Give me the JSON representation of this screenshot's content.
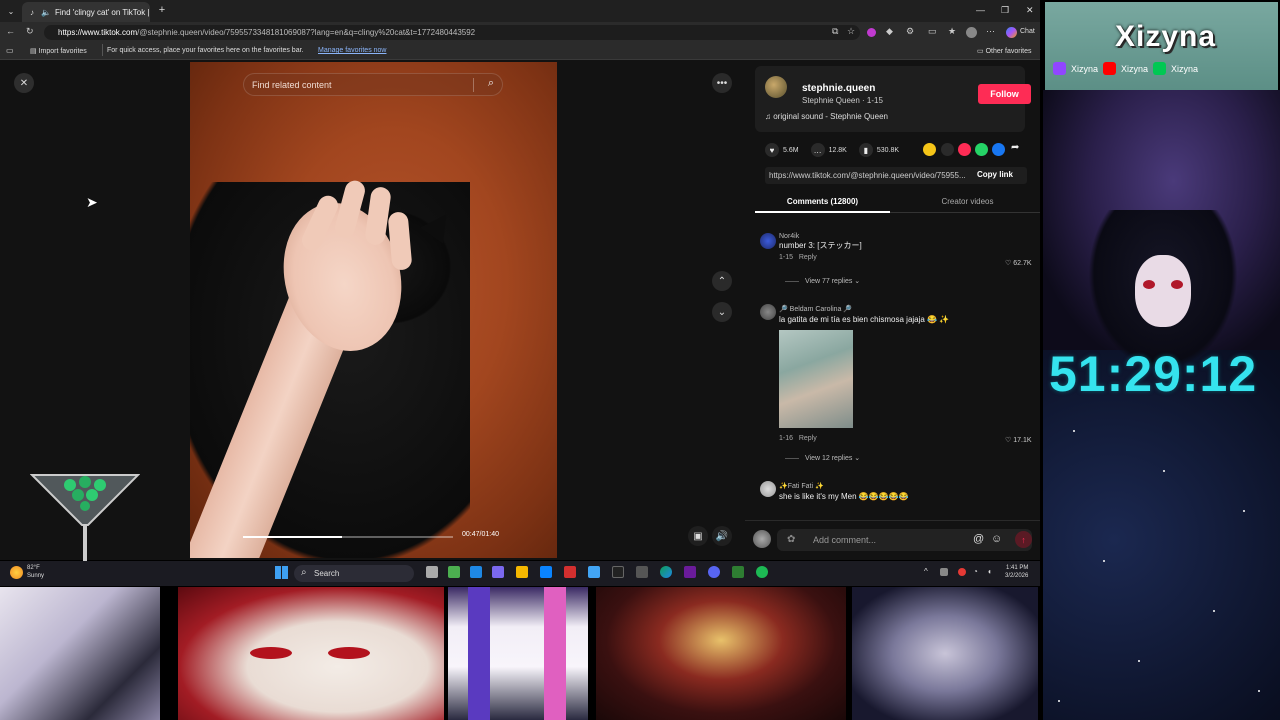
{
  "browser": {
    "tab_title": "Find 'clingy cat' on TikTok | Ti",
    "url_host": "https://www.tiktok.com",
    "url_path": "/@stephnie.queen/video/7595573348181069087?lang=en&q=clingy%20cat&t=1772480443592",
    "fav_import": "Import favorites",
    "fav_hint": "For quick access, place your favorites here on the favorites bar.",
    "fav_manage": "Manage favorites now",
    "fav_other": "Other favorites",
    "chat_label": "Chat"
  },
  "video": {
    "search_placeholder": "Find related content",
    "time": "00:47/01:40",
    "progress": 0.47
  },
  "author": {
    "username": "stephnie.queen",
    "subline": "Stephnie Queen · 1-15",
    "follow": "Follow",
    "sound": "original sound - Stephnie Queen"
  },
  "stats": {
    "likes": "5.6M",
    "comments": "12.8K",
    "saves": "530.8K"
  },
  "share": {
    "link": "https://www.tiktok.com/@stephnie.queen/video/75955...",
    "copy": "Copy link"
  },
  "tabs": {
    "comments": "Comments (12800)",
    "creator": "Creator videos"
  },
  "comments": [
    {
      "user": "Nor4ik",
      "text": "number 3: [ステッカー]",
      "date": "1-15",
      "reply": "Reply",
      "likes": "62.7K",
      "view": "View 77 replies"
    },
    {
      "user": "🔎 Beldam Carolina 🔎",
      "text": "la gatita de mi tía es bien chismosa jajaja 😂 ✨",
      "date": "1-16",
      "reply": "Reply",
      "likes": "17.1K",
      "view": "View 12 replies"
    },
    {
      "user": "✨Fati Fati ✨",
      "text": "she is like it's my Men 😂😂😂😂😂"
    }
  ],
  "composer": {
    "placeholder": "Add comment..."
  },
  "taskbar": {
    "temp": "82°F",
    "weather": "Sunny",
    "search": "Search",
    "time": "1:41 PM",
    "date": "3/2/2026"
  },
  "overlay": {
    "streamer": "Xizyna",
    "social1": "Xizyna",
    "social2": "Xizyna",
    "social3": "Xizyna",
    "timer": "51:29:12"
  },
  "colors": {
    "accent": "#fe2c55",
    "timer": "#35e3ee"
  }
}
